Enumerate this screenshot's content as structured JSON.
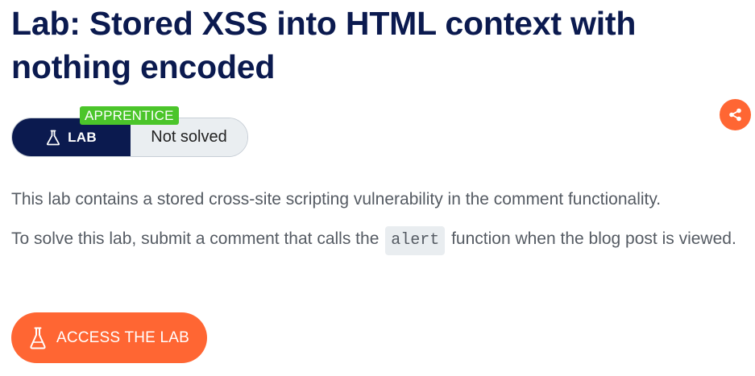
{
  "page": {
    "title": "Lab: Stored XSS into HTML context with nothing encoded"
  },
  "badge": {
    "type_label": "LAB",
    "status_label": "Not solved",
    "level_label": "APPRENTICE",
    "lab_icon": "flask-icon"
  },
  "share": {
    "icon": "share-icon"
  },
  "description": {
    "line1": "This lab contains a stored cross-site scripting vulnerability in the comment functionality.",
    "line2_before": "To solve this lab, submit a comment that calls the ",
    "line2_code": "alert",
    "line2_after": " function when the blog post is viewed."
  },
  "access_button": {
    "label": "ACCESS THE LAB",
    "icon": "flask-icon"
  },
  "colors": {
    "title": "#0b1a4f",
    "accent": "#ff6633",
    "level": "#4bc52a",
    "status_bg": "#eaeef1"
  }
}
